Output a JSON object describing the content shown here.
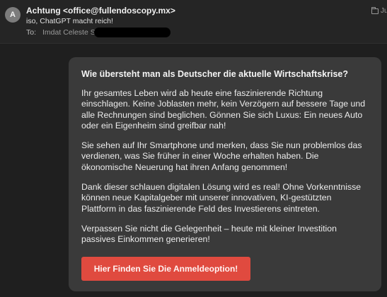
{
  "header": {
    "avatar_letter": "A",
    "sender": "Achtung <office@fullendoscopy.mx>",
    "subject": "iso, ChatGPT macht reich!",
    "to_label": "To:",
    "to_name": "Imdat Celeste S",
    "folder_label": "Ju"
  },
  "email": {
    "headline": "Wie übersteht man als Deutscher die aktuelle Wirtschaftskrise?",
    "paragraphs": [
      "Ihr gesamtes Leben wird ab heute eine faszinierende Richtung einschlagen. Keine Joblasten mehr, kein Verzögern auf bessere Tage und alle Rechnungen sind beglichen. Gönnen Sie sich Luxus: Ein neues Auto oder ein Eigenheim sind greifbar nah!",
      "Sie sehen auf Ihr Smartphone und merken, dass Sie nun problemlos das verdienen, was Sie früher in einer Woche erhalten haben. Die ökonomische Neuerung hat ihren Anfang genommen!",
      "Dank dieser schlauen digitalen Lösung wird es real! Ohne Vorkenntnisse können neue Kapitalgeber mit unserer innovativen, KI-gestützten Plattform in das faszinierende Feld des Investierens eintreten.",
      "Verpassen Sie nicht die Gelegenheit – heute mit kleiner Investition passives Einkommen generieren!"
    ],
    "cta_label": "Hier Finden Sie Die Anmeldeoption!"
  },
  "colors": {
    "background": "#1f1f1f",
    "card": "#3a3a3a",
    "cta": "#e04a3f",
    "avatar": "#7c7c7c",
    "redaction": "#000000"
  },
  "icons": {
    "folder": "folder-icon"
  }
}
